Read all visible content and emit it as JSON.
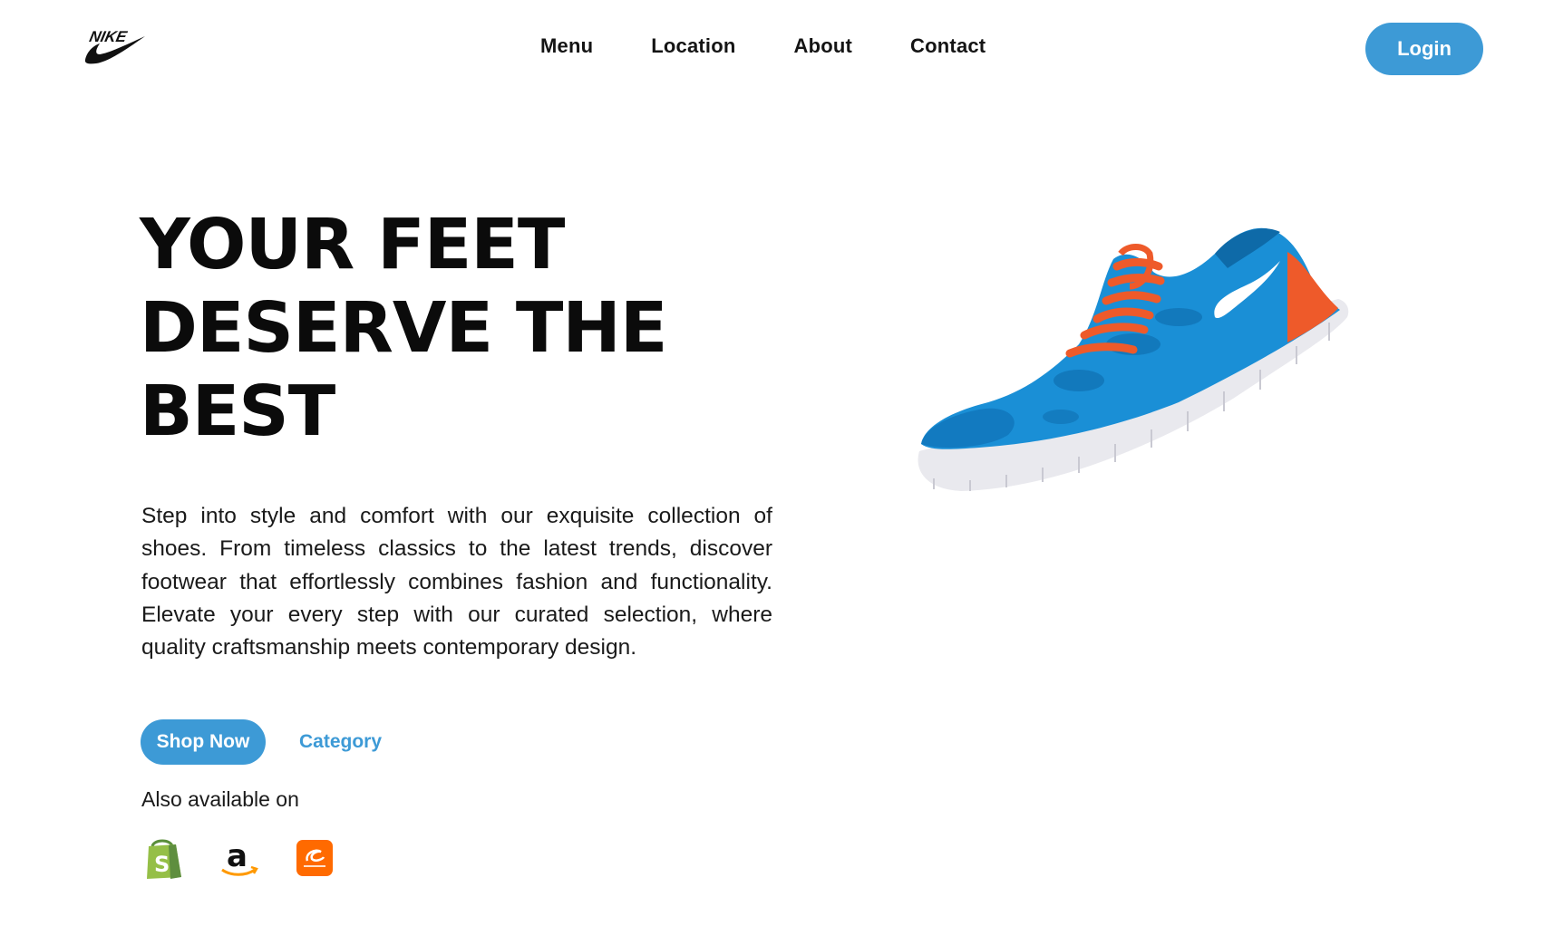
{
  "header": {
    "logo_text": "NIKE",
    "nav": [
      {
        "label": "Menu"
      },
      {
        "label": "Location"
      },
      {
        "label": "About"
      },
      {
        "label": "Contact"
      }
    ],
    "login_label": "Login"
  },
  "hero": {
    "title_lines": [
      "YOUR FEET",
      "DESERVE THE",
      "BEST"
    ],
    "description": "Step into style and comfort with our exquisite collection of shoes. From timeless classics to the latest trends, discover footwear that effortlessly combines fashion and functionality. Elevate your every step with our curated selection, where quality craftsmanship meets contemporary design.",
    "primary_cta": "Shop Now",
    "secondary_cta": "Category",
    "available_label": "Also available on",
    "stores": [
      {
        "name": "Shopify",
        "icon": "shopify-icon"
      },
      {
        "name": "Amazon",
        "icon": "amazon-icon"
      },
      {
        "name": "Alibaba",
        "icon": "alibaba-icon"
      }
    ],
    "product_image": "blue-running-shoe"
  },
  "colors": {
    "accent": "#3d9ad6",
    "text": "#0b0b0b",
    "background": "#ffffff",
    "shoe_blue": "#1a8fd6",
    "shoe_orange": "#ee5a2a"
  }
}
